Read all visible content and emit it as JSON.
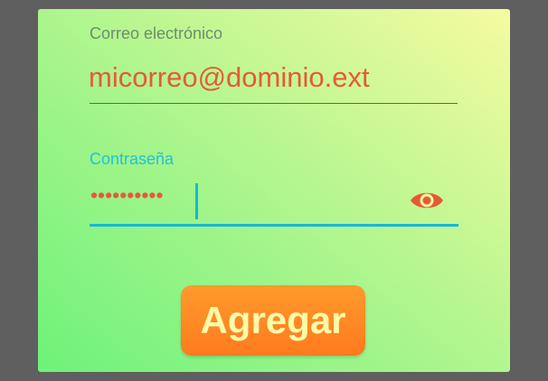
{
  "form": {
    "email": {
      "label": "Correo electrónico",
      "value": "micorreo@dominio.ext"
    },
    "password": {
      "label": "Contraseña",
      "masked_value": "••••••••••",
      "visibility_icon": "eye-icon"
    },
    "submit_label": "Agregar"
  },
  "colors": {
    "accent": "#17b7d6",
    "text_value": "#e75a35",
    "button": "#ff8a25",
    "button_text": "#fdfaa8"
  }
}
